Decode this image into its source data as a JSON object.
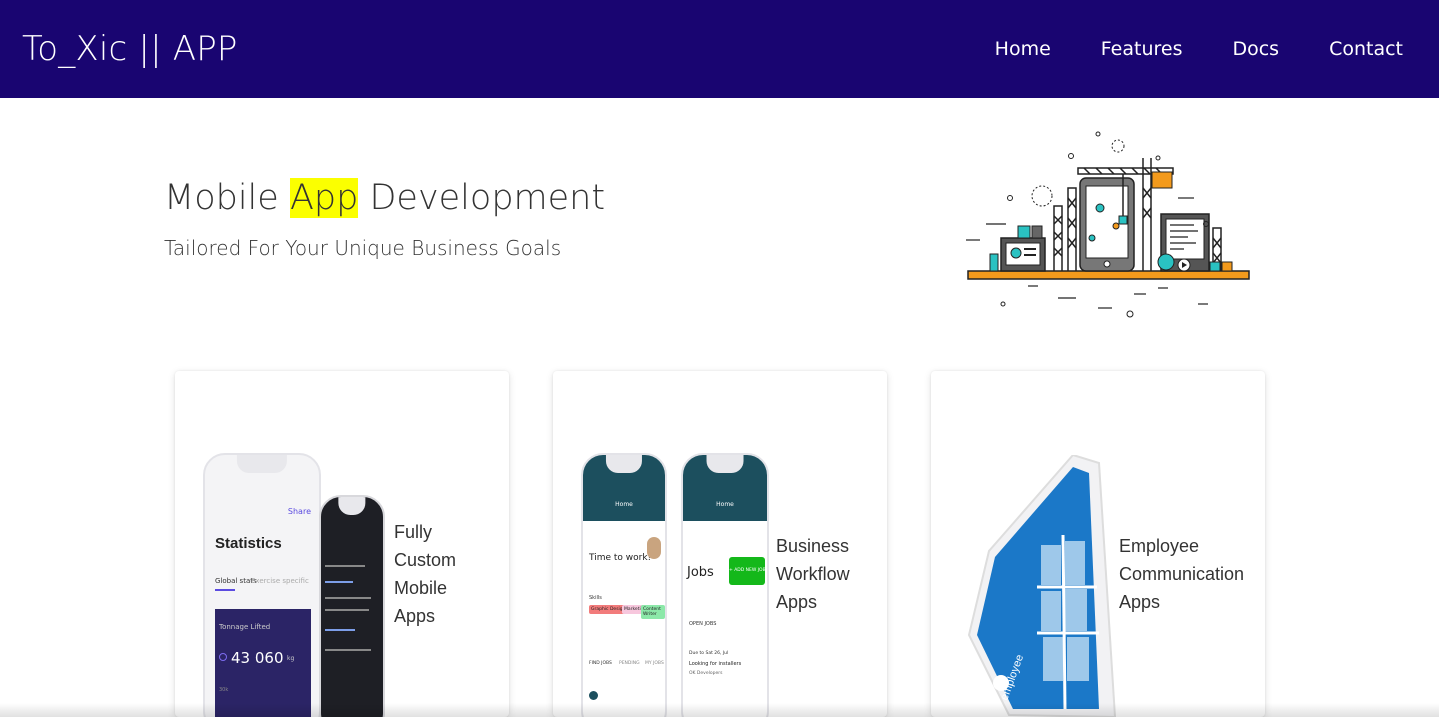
{
  "nav": {
    "brand": "To_Xic || APP",
    "links": [
      "Home",
      "Features",
      "Docs",
      "Contact"
    ]
  },
  "hero": {
    "title_before": "Mobile ",
    "title_highlight": "App",
    "title_after": " Development",
    "subtitle": "Tailored For Your Unique Business Goals"
  },
  "cards": [
    {
      "label": "Fully\nCustom\nMobile\nApps",
      "screen": {
        "share": "Share",
        "heading": "Statistics",
        "tab_active": "Global stats",
        "tab_inactive": "Exercise specific",
        "panel_title": "Tonnage Lifted",
        "panel_value": "43 060",
        "panel_unit": "kg",
        "panel_axis": "30k"
      }
    },
    {
      "label": "Business\nWorkflow\nApps",
      "screen": {
        "nav_title": "Home",
        "greeting": "Time to work!",
        "skills": "Skills",
        "chip1": "Graphic Designers",
        "chip2": "Marketing",
        "chip3": "Content Writer",
        "tabs": [
          "FIND JOBS",
          "PENDING",
          "MY JOBS"
        ],
        "jobs_title": "Jobs",
        "add_job": "+ ADD NEW JOB",
        "open_jobs": "OPEN JOBS",
        "due": "Due to Sat 26, Jul",
        "job_title": "Looking for installers",
        "job_company": "OK Developers"
      }
    },
    {
      "label": "Employee\nCommunication\nApps",
      "screen": {
        "brand": "employee"
      }
    }
  ],
  "colors": {
    "nav_bg": "#190571",
    "highlight": "#fbff00",
    "teal_header": "#1c4f5e",
    "green_button": "#14b81a",
    "purple_panel": "#2b2466",
    "blue_app": "#1b78c8"
  }
}
